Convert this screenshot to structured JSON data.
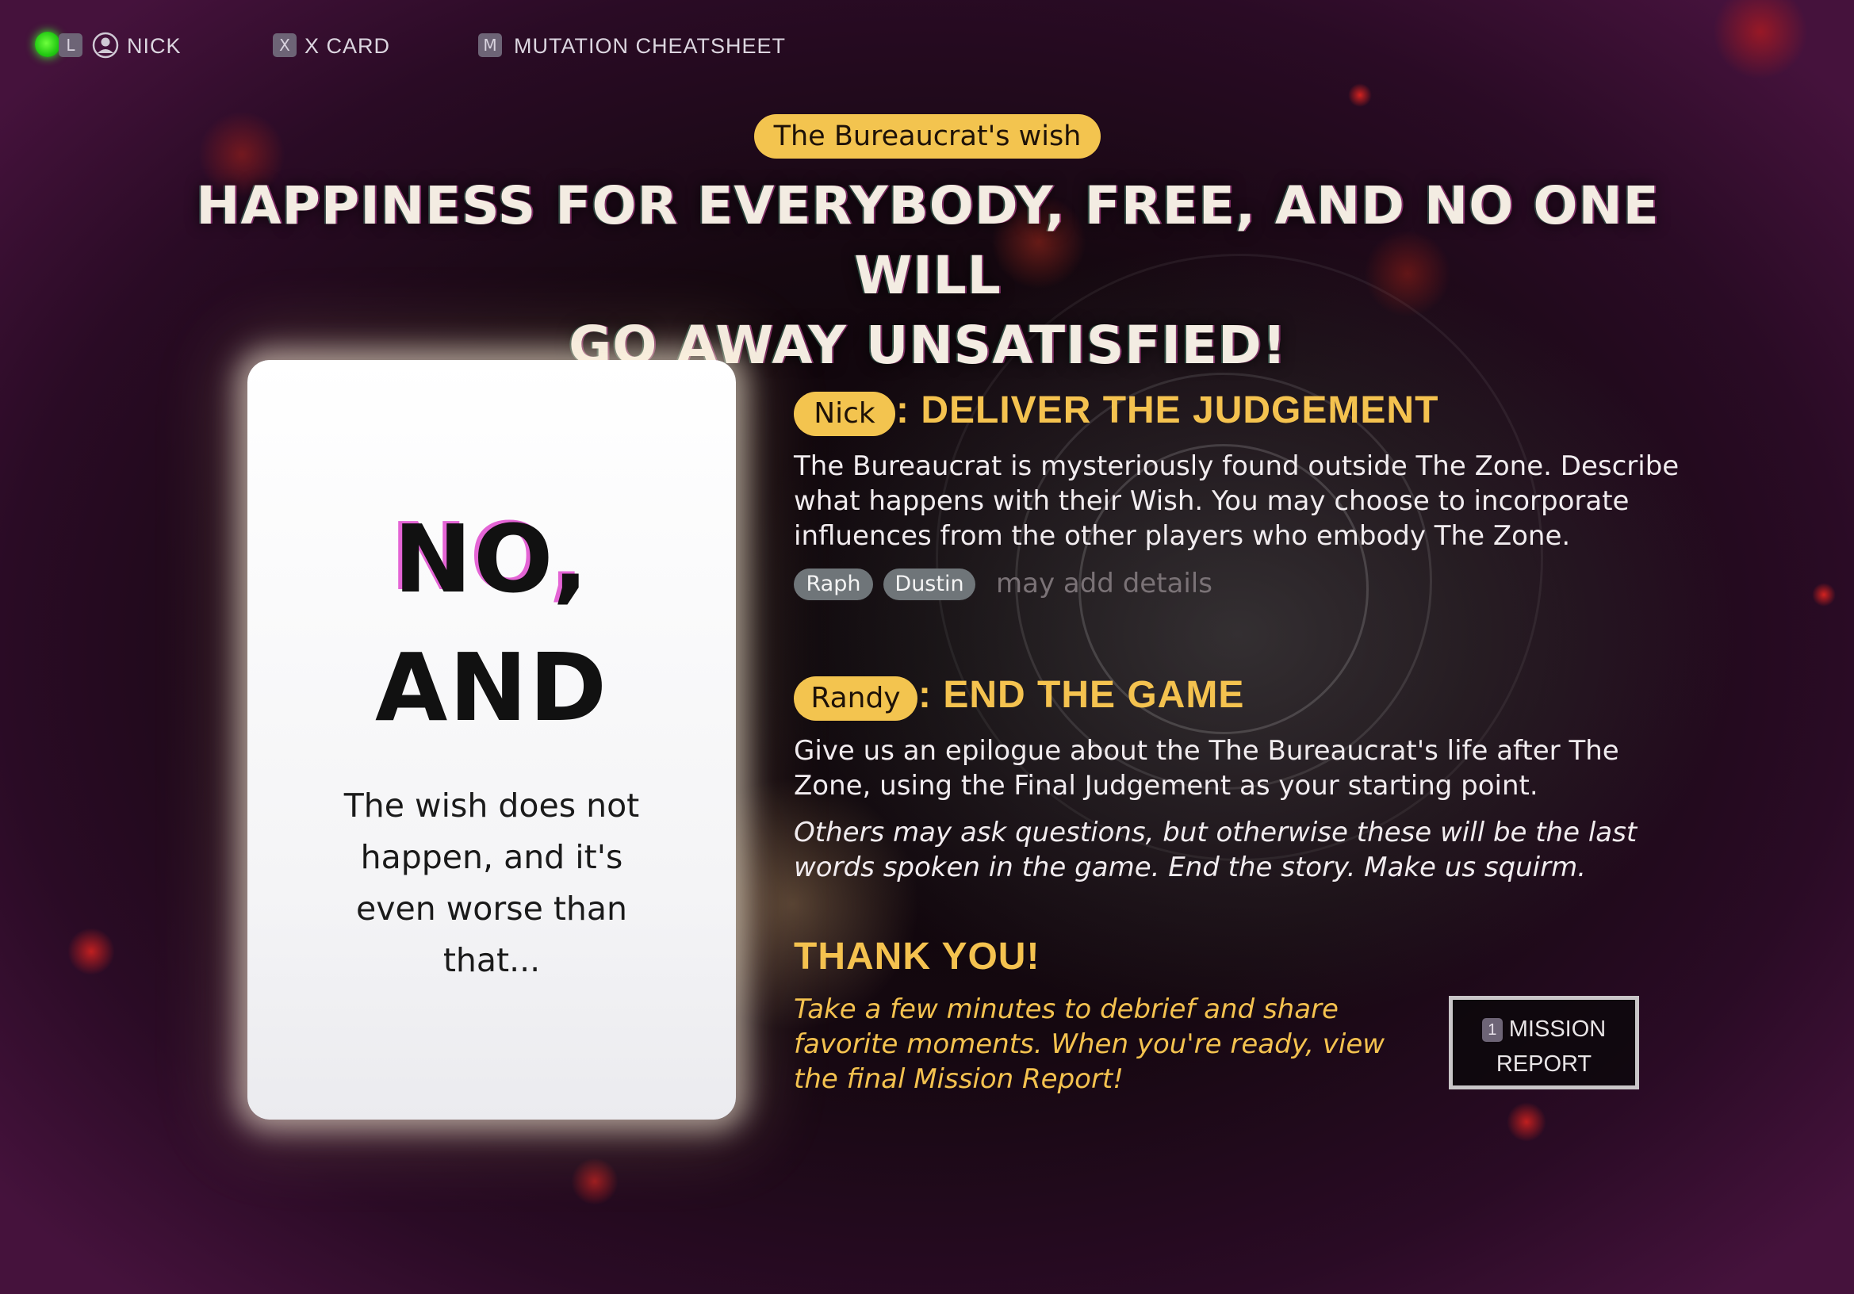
{
  "topbar": {
    "status_key": "L",
    "user_name": "NICK",
    "xcard_key": "X",
    "xcard_label": "X CARD",
    "cheatsheet_key": "M",
    "cheatsheet_label": "MUTATION CHEATSHEET"
  },
  "header": {
    "wish_pill": "The Bureaucrat's wish",
    "wish_line1": "HAPPINESS FOR EVERYBODY, FREE, AND NO ONE WILL",
    "wish_line2": "GO AWAY UNSATISFIED!"
  },
  "card": {
    "heading_line1": "NO,",
    "heading_line2": "AND",
    "body_lines": [
      "The wish does not",
      "happen, and it's",
      "even worse than",
      "that..."
    ]
  },
  "judgement": {
    "player": "Nick",
    "heading": ": DELIVER THE JUDGEMENT",
    "text_lines": [
      "The Bureaucrat is mysteriously found outside The Zone. Describe",
      "what happens with their Wish. You may choose to incorporate",
      "influences from the other players who embody The Zone."
    ],
    "tags": [
      "Raph",
      "Dustin"
    ],
    "tags_note": "may add details"
  },
  "endgame": {
    "player": "Randy",
    "heading": ": END THE GAME",
    "text_lines": [
      "Give us an epilogue about the The Bureaucrat's life after The",
      "Zone, using the Final Judgement as your starting point."
    ],
    "italic_lines": [
      "Others may ask questions, but otherwise these will be the last",
      "words spoken in the game. End the story. Make us squirm."
    ]
  },
  "thanks": {
    "heading": "THANK YOU!",
    "text_lines": [
      "Take a few minutes to debrief and share",
      "favorite moments. When you're ready, view",
      "the final Mission Report!"
    ]
  },
  "mission_button": {
    "key": "1",
    "line1": "MISSION",
    "line2": "REPORT"
  },
  "colors": {
    "accent_gold": "#f3c44f",
    "background": "#150810",
    "frame_purple": "#45123c",
    "status_green": "#22c912"
  }
}
